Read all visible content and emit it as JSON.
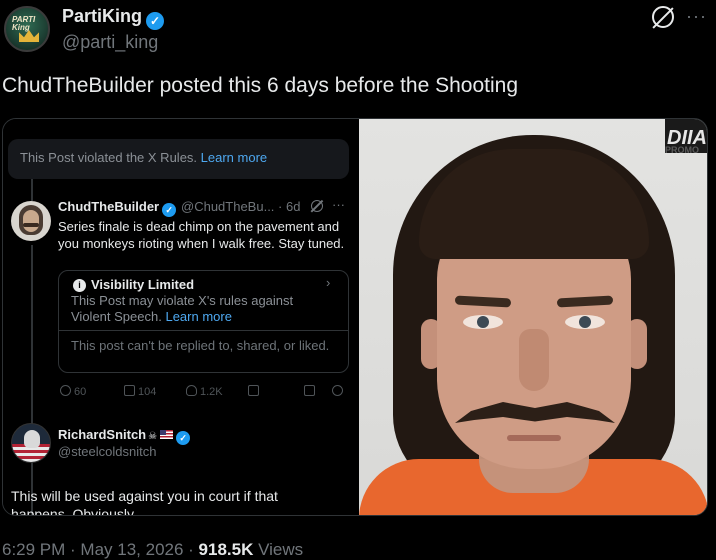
{
  "author": {
    "name": "PartiKing",
    "handle": "@parti_king",
    "avatar_text": "PARTI\nKing",
    "verified": true
  },
  "tweet": {
    "text": "ChudTheBuilder posted this 6 days before the Shooting"
  },
  "screenshot": {
    "violation_text": "This Post violated the X Rules.",
    "violation_link": "Learn more",
    "reply": {
      "name": "ChudTheBuilder",
      "meta": "@ChudTheBu... · 6d",
      "body": "Series finale is dead chimp on the pavement and you monkeys rioting when I walk free. Stay tuned."
    },
    "visibility": {
      "title": "Visibility Limited",
      "description": "This Post may violate X's rules against Violent Speech.",
      "description_link": "Learn more",
      "note": "This post can't be replied to, shared, or liked."
    },
    "actions": {
      "replies": "60",
      "reposts": "104",
      "likes": "1.2K"
    },
    "second_reply": {
      "name": "RichardSnitch",
      "handle": "@steelcoldsnitch",
      "body": "This will be used against you in court if that happens. Obviously."
    }
  },
  "photo": {
    "sign_text": "DIIA",
    "promo_text": "PROMO"
  },
  "footer": {
    "time": "6:29 PM · May 13, 2026 · ",
    "views_count": "918.5K",
    "views_label": " Views"
  },
  "colors": {
    "background": "#000000",
    "text": "#e7e9ea",
    "secondary": "#71767b",
    "link": "#4ea8f0",
    "verified": "#1d9bf0"
  }
}
